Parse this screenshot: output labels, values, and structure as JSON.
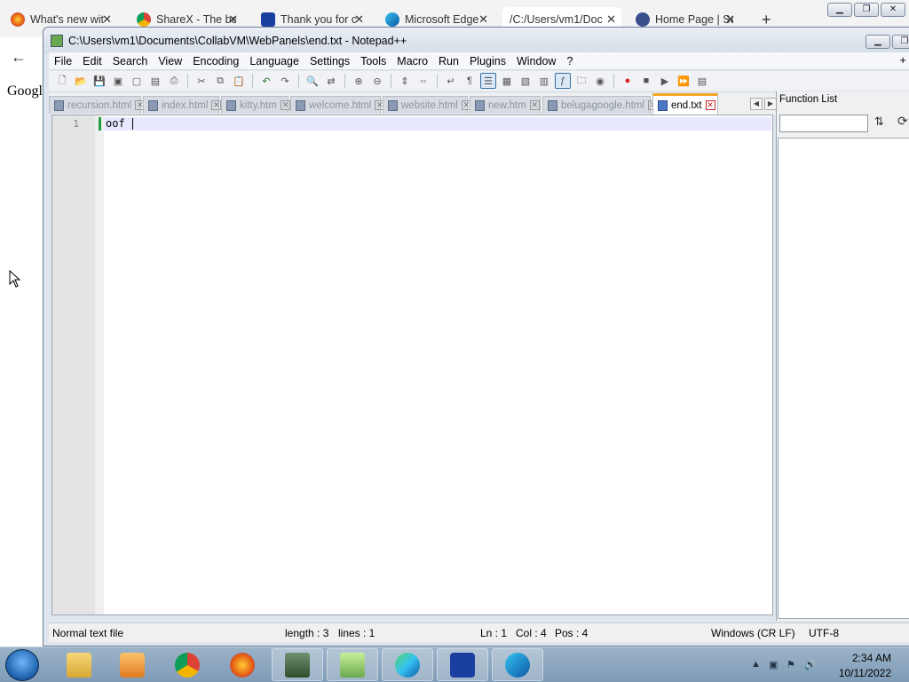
{
  "browser": {
    "tabs": [
      {
        "title": "What's new wit",
        "icon": "firefox-icon"
      },
      {
        "title": "ShareX - The be",
        "icon": "chrome-icon"
      },
      {
        "title": "Thank you for c",
        "icon": "malwarebytes-icon"
      },
      {
        "title": "Microsoft Edge",
        "icon": "edge-icon"
      },
      {
        "title": "/C:/Users/vm1/Doc",
        "icon": "none"
      },
      {
        "title": "Home Page | Se",
        "icon": "site-icon"
      }
    ],
    "new_tab": "+",
    "back": "←",
    "page_text": "Googl"
  },
  "npp": {
    "title": "C:\\Users\\vm1\\Documents\\CollabVM\\WebPanels\\end.txt - Notepad++",
    "menu": [
      "File",
      "Edit",
      "Search",
      "View",
      "Encoding",
      "Language",
      "Settings",
      "Tools",
      "Macro",
      "Run",
      "Plugins",
      "Window",
      "?"
    ],
    "menu_plus": "+",
    "doc_tabs": [
      "recursion.html",
      "index.html",
      "kitty.htm",
      "welcome.html",
      "website.html",
      "new.htm",
      "belugagoogle.html",
      "end.txt"
    ],
    "active_tab": "end.txt",
    "editor": {
      "line_number": "1",
      "content": "oof"
    },
    "function_list": {
      "title": "Function List",
      "sort_icon": "sort-icon",
      "reload_icon": "reload-icon"
    },
    "status": {
      "type": "Normal text file",
      "length": "length : 3",
      "lines": "lines : 1",
      "ln": "Ln : 1",
      "col": "Col : 4",
      "pos": "Pos : 4",
      "eol": "Windows (CR LF)",
      "encoding": "UTF-8"
    }
  },
  "taskbar": {
    "apps": [
      "explorer-icon",
      "media-player-icon",
      "chrome-icon",
      "firefox-icon",
      "task-manager-icon",
      "notepadpp-icon",
      "edge-icon",
      "malwarebytes-icon",
      "edge-beta-icon"
    ],
    "time": "2:34 AM",
    "date": "10/11/2022"
  },
  "colors": {
    "accent_tab": "#f5a623",
    "current_line": "#e8e8ff",
    "change_marker": "#1f9d3a"
  }
}
